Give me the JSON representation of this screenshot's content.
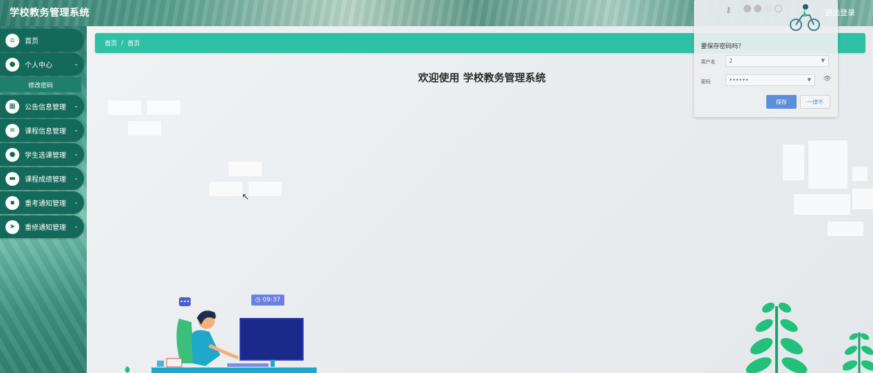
{
  "header": {
    "app_title": "学校教务管理系统",
    "logout_label": "退出登录"
  },
  "sidebar": {
    "items": [
      {
        "label": "首页",
        "icon": "home-icon"
      },
      {
        "label": "个人中心",
        "icon": "user-icon",
        "expanded": true
      },
      {
        "label": "公告信息管理",
        "icon": "grid-icon"
      },
      {
        "label": "课程信息管理",
        "icon": "list-icon"
      },
      {
        "label": "学生选课管理",
        "icon": "user-icon"
      },
      {
        "label": "课程成绩管理",
        "icon": "chat-icon"
      },
      {
        "label": "重考通知管理",
        "icon": "apps-icon"
      },
      {
        "label": "重修通知管理",
        "icon": "send-icon"
      }
    ],
    "submenu": {
      "label": "修改密码"
    }
  },
  "breadcrumb": {
    "root": "首页",
    "separator": "/",
    "current": "首页"
  },
  "main": {
    "welcome": "欢迎使用 学校教务管理系统"
  },
  "password_prompt": {
    "title": "要保存密码吗？",
    "username_label": "用户名",
    "username_value": "2",
    "password_label": "密码",
    "password_value": "••••••",
    "save_label": "保存",
    "never_label": "一律不"
  },
  "illustration": {
    "clock_time": "09:37",
    "chat_glyph": "•••"
  },
  "colors": {
    "accent": "#2ec1a5",
    "sidebar_item": "#13695a",
    "save_button": "#5b8fd9"
  }
}
